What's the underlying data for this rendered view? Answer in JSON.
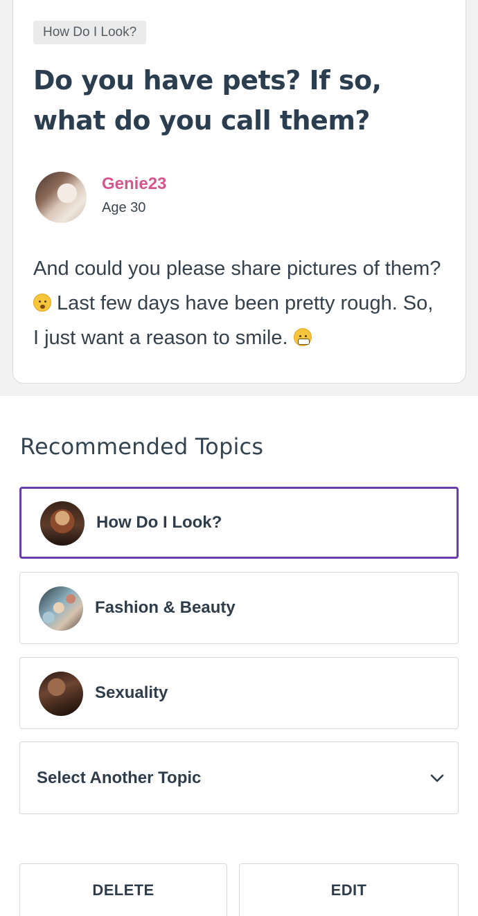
{
  "post": {
    "topic_tag": "How Do I Look?",
    "title": "Do you have pets? If so, what do you call them?",
    "author": {
      "name": "Genie23",
      "age": "Age 30"
    },
    "body_part1": "And could you please share pictures of them?",
    "body_part2": " Last few days have been pretty rough. So, I just want a reason to smile.",
    "emoji_1": "hushed-face-icon",
    "emoji_2": "grimacing-face-icon"
  },
  "recommended": {
    "heading": "Recommended Topics",
    "topics": [
      {
        "label": "How Do I Look?",
        "selected": true,
        "thumb": "portrait-thumbnail"
      },
      {
        "label": "Fashion & Beauty",
        "selected": false,
        "thumb": "makeup-thumbnail"
      },
      {
        "label": "Sexuality",
        "selected": false,
        "thumb": "silhouette-thumbnail"
      }
    ],
    "select_label": "Select Another Topic"
  },
  "actions": {
    "delete_label": "DELETE",
    "edit_label": "EDIT"
  },
  "colors": {
    "accent_selected_border": "#6a3dae",
    "author_name": "#d6558c",
    "text_primary": "#2b3e50"
  }
}
